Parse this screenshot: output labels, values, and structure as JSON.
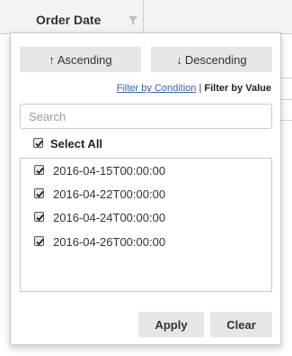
{
  "column": {
    "title": "Order Date"
  },
  "icons": {
    "filter": "filter-icon",
    "arrow_up": "↑",
    "arrow_down": "↓"
  },
  "sort": {
    "ascending_label": "Ascending",
    "descending_label": "Descending"
  },
  "filter_mode": {
    "condition_label": "Filter by Condition",
    "separator": "|",
    "value_label": "Filter by Value",
    "active": "value"
  },
  "search": {
    "placeholder": "Search",
    "value": ""
  },
  "select_all": {
    "label": "Select All",
    "checked": true
  },
  "values": [
    {
      "label": "2016-04-15T00:00:00",
      "checked": true
    },
    {
      "label": "2016-04-22T00:00:00",
      "checked": true
    },
    {
      "label": "2016-04-24T00:00:00",
      "checked": true
    },
    {
      "label": "2016-04-26T00:00:00",
      "checked": true
    }
  ],
  "actions": {
    "apply_label": "Apply",
    "clear_label": "Clear"
  },
  "colors": {
    "button_bg": "#e6e6e6",
    "link": "#3a5fa8",
    "border": "#c9c9c9"
  }
}
